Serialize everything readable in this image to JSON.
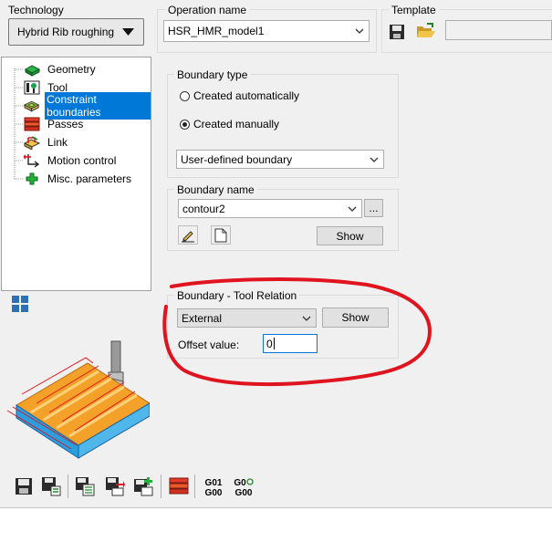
{
  "technology": {
    "label": "Technology",
    "value": "Hybrid Rib roughing"
  },
  "operation": {
    "label": "Operation name",
    "value": "HSR_HMR_model1"
  },
  "template": {
    "label": "Template",
    "value": ""
  },
  "tree": {
    "items": [
      {
        "label": "Geometry",
        "icon": "geometry-icon"
      },
      {
        "label": "Tool",
        "icon": "tool-icon"
      },
      {
        "label": "Constraint boundaries",
        "icon": "constraint-boundaries-icon",
        "selected": true
      },
      {
        "label": "Passes",
        "icon": "passes-icon"
      },
      {
        "label": "Link",
        "icon": "link-icon"
      },
      {
        "label": "Motion control",
        "icon": "motion-control-icon"
      },
      {
        "label": "Misc. parameters",
        "icon": "misc-parameters-icon"
      }
    ]
  },
  "boundary_type": {
    "title": "Boundary type",
    "option_auto": "Created automatically",
    "option_manual": "Created manually",
    "selected": "manual",
    "dropdown_value": "User-defined boundary"
  },
  "boundary_name": {
    "title": "Boundary name",
    "value": "contour2",
    "browse_label": "...",
    "show_label": "Show"
  },
  "tool_relation": {
    "title": "Boundary - Tool Relation",
    "dropdown_value": "External",
    "show_label": "Show",
    "offset_label": "Offset value:",
    "offset_value": "0"
  },
  "bottom_toolbar": {
    "g01_top": "G01",
    "g01_bottom": "G00",
    "g0_top": "G0",
    "g0_bottom": "G00"
  },
  "colors": {
    "annotation": "#e0141e",
    "selection": "#0078d7"
  }
}
